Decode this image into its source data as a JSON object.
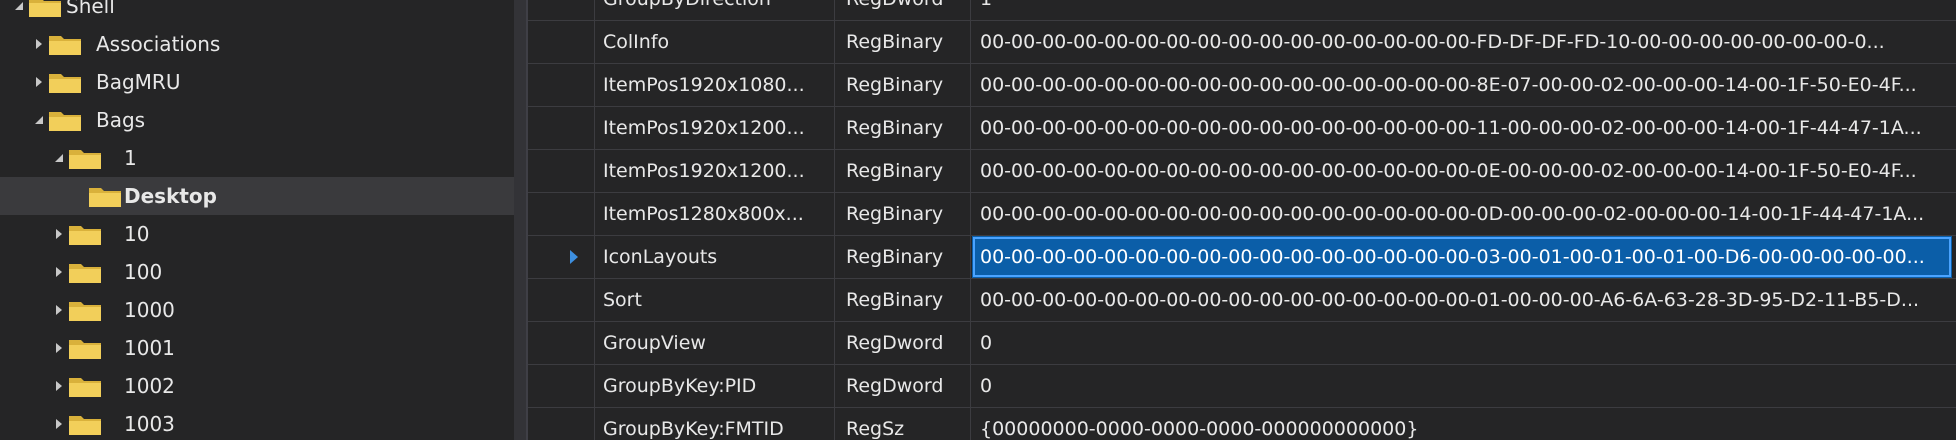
{
  "colors": {
    "background": "#252526",
    "selection": "#0b5ea8",
    "folder": "#f2cf5a",
    "text": "#e8e8e8"
  },
  "tree": {
    "nodes": [
      {
        "label": "Shell",
        "expanded": true
      },
      {
        "label": "Associations",
        "expanded": false
      },
      {
        "label": "BagMRU",
        "expanded": false
      },
      {
        "label": "Bags",
        "expanded": true
      },
      {
        "label": "1",
        "expanded": true
      },
      {
        "label": "Desktop",
        "selected": true
      },
      {
        "label": "10",
        "expanded": false
      },
      {
        "label": "100",
        "expanded": false
      },
      {
        "label": "1000",
        "expanded": false
      },
      {
        "label": "1001",
        "expanded": false
      },
      {
        "label": "1002",
        "expanded": false
      },
      {
        "label": "1003",
        "expanded": false
      }
    ]
  },
  "values": {
    "rows": [
      {
        "name": "GroupByDirection",
        "type": "RegDword",
        "data": "1"
      },
      {
        "name": "ColInfo",
        "type": "RegBinary",
        "data": "00-00-00-00-00-00-00-00-00-00-00-00-00-00-00-00-FD-DF-DF-FD-10-00-00-00-00-00-00-00-0..."
      },
      {
        "name": "ItemPos1920x1080...",
        "type": "RegBinary",
        "data": "00-00-00-00-00-00-00-00-00-00-00-00-00-00-00-00-8E-07-00-00-02-00-00-00-14-00-1F-50-E0-4F..."
      },
      {
        "name": "ItemPos1920x1200...",
        "type": "RegBinary",
        "data": "00-00-00-00-00-00-00-00-00-00-00-00-00-00-00-00-11-00-00-00-02-00-00-00-14-00-1F-44-47-1A..."
      },
      {
        "name": "ItemPos1920x1200...",
        "type": "RegBinary",
        "data": "00-00-00-00-00-00-00-00-00-00-00-00-00-00-00-00-0E-00-00-00-02-00-00-00-14-00-1F-50-E0-4F..."
      },
      {
        "name": "ItemPos1280x800x...",
        "type": "RegBinary",
        "data": "00-00-00-00-00-00-00-00-00-00-00-00-00-00-00-00-0D-00-00-00-02-00-00-00-14-00-1F-44-47-1A..."
      },
      {
        "name": "IconLayouts",
        "type": "RegBinary",
        "data": "00-00-00-00-00-00-00-00-00-00-00-00-00-00-00-00-03-00-01-00-01-00-01-00-D6-00-00-00-00-00...",
        "selected": true
      },
      {
        "name": "Sort",
        "type": "RegBinary",
        "data": "00-00-00-00-00-00-00-00-00-00-00-00-00-00-00-00-01-00-00-00-A6-6A-63-28-3D-95-D2-11-B5-D..."
      },
      {
        "name": "GroupView",
        "type": "RegDword",
        "data": "0"
      },
      {
        "name": "GroupByKey:PID",
        "type": "RegDword",
        "data": "0"
      },
      {
        "name": "GroupByKey:FMTID",
        "type": "RegSz",
        "data": "{00000000-0000-0000-0000-000000000000}"
      }
    ]
  }
}
